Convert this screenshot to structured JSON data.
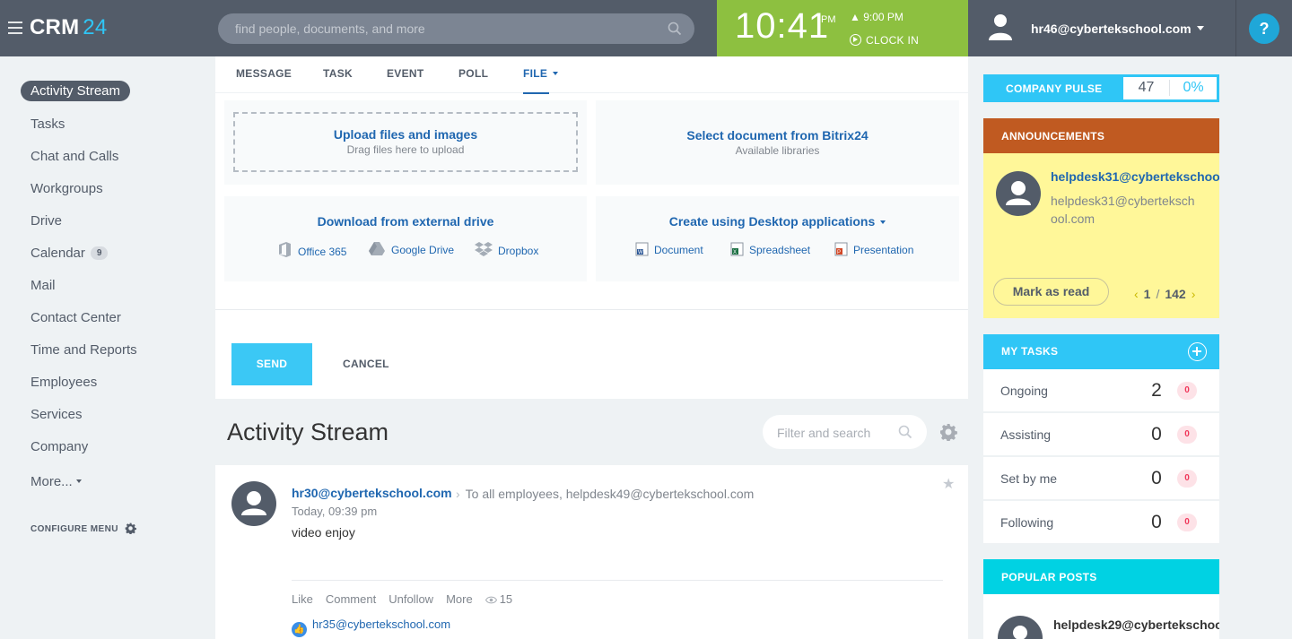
{
  "header": {
    "logo_main": "CRM",
    "logo_num": "24",
    "search_placeholder": "find people, documents, and more",
    "clock_time": "10:41",
    "clock_ampm": "PM",
    "alarm_time": "9:00 PM",
    "clock_in_label": "CLOCK IN",
    "user_email": "hr46@cybertekschool.com",
    "help_label": "?"
  },
  "nav": {
    "items": [
      {
        "label": "Activity Stream"
      },
      {
        "label": "Tasks"
      },
      {
        "label": "Chat and Calls"
      },
      {
        "label": "Workgroups"
      },
      {
        "label": "Drive"
      },
      {
        "label": "Calendar",
        "count": "9"
      },
      {
        "label": "Mail"
      },
      {
        "label": "Contact Center"
      },
      {
        "label": "Time and Reports"
      },
      {
        "label": "Employees"
      },
      {
        "label": "Services"
      },
      {
        "label": "Company"
      },
      {
        "label": "More..."
      }
    ],
    "configure_label": "CONFIGURE MENU"
  },
  "composer": {
    "tabs": [
      "MESSAGE",
      "TASK",
      "EVENT",
      "POLL",
      "FILE"
    ],
    "upload_title": "Upload files and images",
    "upload_sub": "Drag files here to upload",
    "select_title": "Select document from Bitrix24",
    "select_sub": "Available libraries",
    "external_title": "Download from external drive",
    "external_links": [
      "Office 365",
      "Google Drive",
      "Dropbox"
    ],
    "desktop_title": "Create using Desktop applications",
    "desktop_links": [
      "Document",
      "Spreadsheet",
      "Presentation"
    ],
    "send_label": "SEND",
    "cancel_label": "CANCEL"
  },
  "stream": {
    "title": "Activity Stream",
    "filter_placeholder": "Filter and search"
  },
  "post": {
    "author": "hr30@cybertekschool.com",
    "recipients": "To all employees, helpdesk49@cybertekschool.com",
    "time": "Today, 09:39 pm",
    "text": "video enjoy",
    "actions": [
      "Like",
      "Comment",
      "Unfollow",
      "More"
    ],
    "views": "15",
    "liked_by": "hr35@cybertekschool.com"
  },
  "right": {
    "pulse_label": "COMPANY PULSE",
    "pulse_value": "47",
    "pulse_pct": "0%",
    "announcements_label": "ANNOUNCEMENTS",
    "announcement_title": "helpdesk31@cybertekschool",
    "announcement_text": "helpdesk31@cybertekschool.com",
    "mark_read_label": "Mark as read",
    "pager_current": "1",
    "pager_total": "142",
    "tasks_label": "MY TASKS",
    "tasks": [
      {
        "label": "Ongoing",
        "count": "2",
        "badge": "0"
      },
      {
        "label": "Assisting",
        "count": "0",
        "badge": "0"
      },
      {
        "label": "Set by me",
        "count": "0",
        "badge": "0"
      },
      {
        "label": "Following",
        "count": "0",
        "badge": "0"
      }
    ],
    "popular_label": "POPULAR POSTS",
    "popular_title": "helpdesk29@cybertekschoo"
  }
}
